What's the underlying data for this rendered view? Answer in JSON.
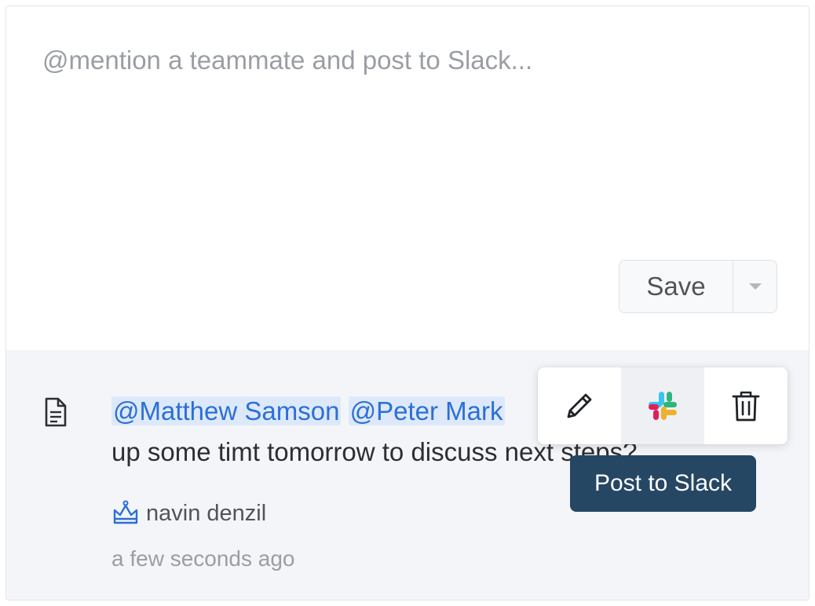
{
  "composer": {
    "placeholder": "@mention a teammate and post to Slack...",
    "value": ""
  },
  "save_button": {
    "label": "Save",
    "dropdown_icon": "caret-down-icon"
  },
  "comment": {
    "icon": "document-icon",
    "mentions": [
      "@Matthew Samson",
      "@Peter Mark"
    ],
    "text_visible_line1_tail": "",
    "text_line2": "up some timt tomorrow to discuss next steps?",
    "author_icon": "crown-icon",
    "author": "navin denzil",
    "timestamp": "a few seconds ago"
  },
  "actions": {
    "edit_icon": "pencil-icon",
    "slack_icon": "slack-icon",
    "delete_icon": "trash-icon"
  },
  "tooltip": {
    "text": "Post to Slack"
  },
  "colors": {
    "mention_text": "#2c6fd6",
    "mention_bg": "#dde9fb",
    "tooltip_bg": "#254764",
    "comment_bg": "#f3f5f8"
  }
}
